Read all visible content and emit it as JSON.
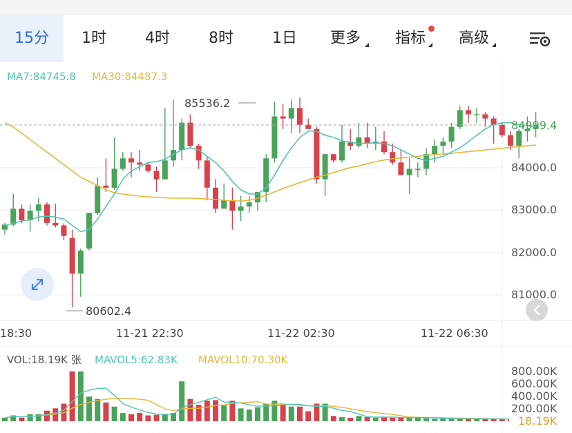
{
  "tabs": [
    {
      "label": "15分",
      "active": true
    },
    {
      "label": "1时",
      "active": false
    },
    {
      "label": "4时",
      "active": false
    },
    {
      "label": "8时",
      "active": false
    },
    {
      "label": "1日",
      "active": false
    },
    {
      "label": "更多",
      "active": false,
      "has_caret": true
    },
    {
      "label": "指标",
      "active": false,
      "has_caret": true,
      "has_dot": true
    },
    {
      "label": "高级",
      "active": false,
      "has_caret": true
    }
  ],
  "settings_icon": "chart-settings-icon",
  "main_indicators": {
    "ma7": "MA7:84745.8",
    "ma30": "MA30:84487.3"
  },
  "colors": {
    "up": "#4aa35a",
    "down": "#d6434c",
    "ma7": "#51c4b8",
    "ma30": "#e9b635",
    "active_tab": "#2a6ad8",
    "price_label": "#4aa35a"
  },
  "price_axis": {
    "current": "84999.4",
    "ticks": [
      "84000.0",
      "83000.0",
      "82000.0",
      "81000.0"
    ]
  },
  "annotations": {
    "high": "85536.2",
    "low": "80602.4"
  },
  "time_axis": [
    "18:30",
    "11-21 22:30",
    "11-22 02:30",
    "11-22 06:30"
  ],
  "volume_indicators": {
    "vol": "VOL:18.19K 张",
    "mavol5": "MAVOL5:62.83K",
    "mavol10": "MAVOL10:70.30K"
  },
  "volume_axis": {
    "ticks": [
      "800.00K",
      "600.00K",
      "400.00K",
      "200.00K"
    ],
    "current": "18.19K"
  },
  "chart_data": {
    "type": "candlestick",
    "ylim": [
      80300,
      85900
    ],
    "candles": [
      [
        82400,
        82560,
        82280,
        82520
      ],
      [
        82520,
        83250,
        82480,
        82900
      ],
      [
        82900,
        83000,
        82550,
        82620
      ],
      [
        82620,
        83000,
        82350,
        82850
      ],
      [
        82850,
        83150,
        82600,
        83000
      ],
      [
        83000,
        83050,
        82500,
        82560
      ],
      [
        82560,
        83020,
        82450,
        82500
      ],
      [
        82500,
        82550,
        82150,
        82250
      ],
      [
        82200,
        82400,
        80550,
        81350
      ],
      [
        81350,
        81950,
        80800,
        81900
      ],
      [
        81950,
        82650,
        81900,
        82800
      ],
      [
        82800,
        83650,
        82750,
        83450
      ],
      [
        83450,
        84100,
        83300,
        83400
      ],
      [
        83400,
        84600,
        83350,
        83850
      ],
      [
        83850,
        84250,
        83800,
        84100
      ],
      [
        84100,
        84250,
        83650,
        84000
      ],
      [
        84000,
        84300,
        83800,
        83950
      ],
      [
        83950,
        84000,
        83750,
        83800
      ],
      [
        83800,
        83900,
        83300,
        83600
      ],
      [
        83600,
        85300,
        83700,
        84050
      ],
      [
        84050,
        85500,
        83900,
        84300
      ],
      [
        84300,
        85050,
        84050,
        84950
      ],
      [
        84950,
        85150,
        84350,
        84400
      ],
      [
        84400,
        84450,
        83850,
        84050
      ],
      [
        84050,
        84150,
        83100,
        83400
      ],
      [
        83400,
        83600,
        82800,
        82900
      ],
      [
        82900,
        83500,
        82900,
        83100
      ],
      [
        83100,
        83400,
        82400,
        82850
      ],
      [
        82850,
        83200,
        82600,
        82950
      ],
      [
        82950,
        83200,
        82800,
        83050
      ],
      [
        83050,
        83300,
        82850,
        83300
      ],
      [
        83300,
        84200,
        83050,
        84100
      ],
      [
        84100,
        85450,
        84000,
        85100
      ],
      [
        85100,
        85400,
        84800,
        85050
      ],
      [
        85050,
        85500,
        84700,
        85300
      ],
      [
        85300,
        85550,
        84700,
        84900
      ],
      [
        84900,
        85050,
        84800,
        84800
      ],
      [
        84800,
        84850,
        83500,
        83600
      ],
      [
        83600,
        84200,
        83200,
        84200
      ],
      [
        84200,
        84200,
        84000,
        84050
      ],
      [
        84050,
        84900,
        84000,
        84500
      ],
      [
        84500,
        84800,
        84300,
        84400
      ],
      [
        84400,
        84950,
        84350,
        84600
      ],
      [
        84600,
        84950,
        84350,
        84450
      ],
      [
        84450,
        84850,
        84300,
        84500
      ],
      [
        84500,
        84750,
        84200,
        84250
      ],
      [
        84250,
        84450,
        83950,
        84000
      ],
      [
        84000,
        84300,
        83700,
        83700
      ],
      [
        83700,
        84100,
        83250,
        83850
      ],
      [
        83850,
        84000,
        83650,
        83850
      ],
      [
        83850,
        84350,
        83700,
        84200
      ],
      [
        84200,
        84550,
        84000,
        84400
      ],
      [
        84400,
        84600,
        84200,
        84500
      ],
      [
        84500,
        84950,
        84350,
        84850
      ],
      [
        84850,
        85350,
        84800,
        85250
      ],
      [
        85250,
        85350,
        84950,
        85150
      ],
      [
        85150,
        85300,
        84950,
        85150
      ],
      [
        85150,
        85200,
        84850,
        85050
      ],
      [
        85050,
        85100,
        84450,
        84900
      ],
      [
        84900,
        84950,
        84600,
        84650
      ],
      [
        84650,
        84750,
        84300,
        84400
      ],
      [
        84400,
        84800,
        84100,
        84750
      ],
      [
        84750,
        85100,
        84500,
        84800
      ],
      [
        84800,
        85200,
        84600,
        84900
      ]
    ],
    "ma7": [
      82500,
      82550,
      82600,
      82640,
      82700,
      82720,
      82700,
      82650,
      82500,
      82350,
      82400,
      82650,
      82950,
      83250,
      83600,
      83800,
      83900,
      84000,
      84020,
      84080,
      84200,
      84300,
      84350,
      84300,
      84150,
      84000,
      83800,
      83550,
      83350,
      83250,
      83250,
      83400,
      83700,
      84050,
      84350,
      84600,
      84750,
      84750,
      84650,
      84600,
      84520,
      84480,
      84450,
      84460,
      84470,
      84450,
      84400,
      84300,
      84200,
      84100,
      84050,
      84100,
      84150,
      84250,
      84350,
      84500,
      84650,
      84800,
      84900,
      84950,
      84950,
      84900,
      84880,
      84850
    ],
    "ma30": [
      84950,
      84850,
      84700,
      84550,
      84400,
      84250,
      84100,
      83950,
      83800,
      83650,
      83550,
      83450,
      83350,
      83280,
      83250,
      83220,
      83200,
      83180,
      83170,
      83160,
      83150,
      83150,
      83150,
      83140,
      83130,
      83120,
      83100,
      83090,
      83080,
      83100,
      83150,
      83220,
      83300,
      83380,
      83450,
      83520,
      83590,
      83650,
      83700,
      83760,
      83820,
      83880,
      83920,
      83970,
      84020,
      84060,
      84090,
      84110,
      84130,
      84150,
      84170,
      84190,
      84200,
      84220,
      84240,
      84260,
      84280,
      84300,
      84320,
      84340,
      84360,
      84380,
      84400,
      84420
    ],
    "volume": [
      0.06,
      0.1,
      0.06,
      0.12,
      0.12,
      0.18,
      0.22,
      0.3,
      0.85,
      0.85,
      0.42,
      0.38,
      0.32,
      0.25,
      0.14,
      0.12,
      0.14,
      0.1,
      0.11,
      0.12,
      0.14,
      0.68,
      0.38,
      0.28,
      0.35,
      0.36,
      0.27,
      0.35,
      0.22,
      0.2,
      0.24,
      0.3,
      0.35,
      0.3,
      0.25,
      0.25,
      0.17,
      0.3,
      0.3,
      0.09,
      0.07,
      0.06,
      0.09,
      0.07,
      0.06,
      0.07,
      0.06,
      0.07,
      0.06,
      0.06,
      0.05,
      0.04,
      0.05,
      0.04,
      0.04,
      0.04,
      0.04,
      0.04,
      0.04,
      0.04,
      0.03,
      0.03,
      0.04,
      0.03
    ]
  }
}
